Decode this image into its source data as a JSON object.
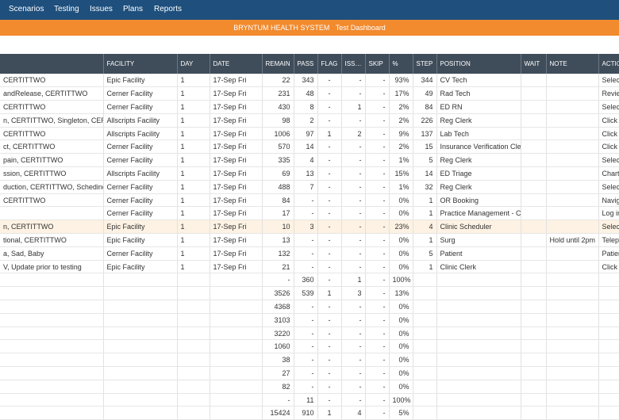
{
  "nav": {
    "items": [
      "Scenarios",
      "Testing",
      "Issues",
      "Plans",
      "Reports"
    ]
  },
  "banner": {
    "org": "BRYNTUM HEALTH SYSTEM",
    "title": "Test Dashboard"
  },
  "colors": {
    "nav_bg": "#1e4f7d",
    "banner_bg": "#f28a2e",
    "header_bg": "#3f4c5a",
    "highlight_row": "#fdf2e3"
  },
  "columns": [
    "",
    "FACILITY",
    "DAY",
    "DATE",
    "REMAIN",
    "PASS",
    "FLAG",
    "ISS…",
    "SKIP",
    "%",
    "STEP",
    "POSITION",
    "WAIT",
    "NOTE",
    "ACTIO"
  ],
  "rows": [
    {
      "name": "CERTITTWO",
      "facility": "Epic Facility",
      "day": "1",
      "date": "17-Sep Fri",
      "remain": "22",
      "pass": "343",
      "flag": "-",
      "issue": "-",
      "skip": "-",
      "pct": "93%",
      "step": "344",
      "position": "CV Tech",
      "wait": "",
      "note": "",
      "action": "Selec"
    },
    {
      "name": "andRelease, CERTITTWO",
      "facility": "Cerner Facility",
      "day": "1",
      "date": "17-Sep Fri",
      "remain": "231",
      "pass": "48",
      "flag": "-",
      "issue": "-",
      "skip": "-",
      "pct": "17%",
      "step": "49",
      "position": "Rad Tech",
      "wait": "",
      "note": "",
      "action": "Revie"
    },
    {
      "name": "CERTITTWO",
      "facility": "Cerner Facility",
      "day": "1",
      "date": "17-Sep Fri",
      "remain": "430",
      "pass": "8",
      "flag": "-",
      "issue": "1",
      "skip": "-",
      "pct": "2%",
      "step": "84",
      "position": "ED RN",
      "wait": "",
      "note": "",
      "action": "Selec"
    },
    {
      "name": "n, CERTITTWO, Singleton, CERT",
      "facility": "Allscripts Facility",
      "day": "1",
      "date": "17-Sep Fri",
      "remain": "98",
      "pass": "2",
      "flag": "-",
      "issue": "-",
      "skip": "-",
      "pct": "2%",
      "step": "226",
      "position": "Reg Clerk",
      "wait": "",
      "note": "",
      "action": "Click"
    },
    {
      "name": "CERTITTWO",
      "facility": "Allscripts Facility",
      "day": "1",
      "date": "17-Sep Fri",
      "remain": "1006",
      "pass": "97",
      "flag": "1",
      "issue": "2",
      "skip": "-",
      "pct": "9%",
      "step": "137",
      "position": "Lab Tech",
      "wait": "",
      "note": "",
      "action": "Click"
    },
    {
      "name": "ct, CERTITTWO",
      "facility": "Cerner Facility",
      "day": "1",
      "date": "17-Sep Fri",
      "remain": "570",
      "pass": "14",
      "flag": "-",
      "issue": "-",
      "skip": "-",
      "pct": "2%",
      "step": "15",
      "position": "Insurance Verification Cler",
      "wait": "",
      "note": "",
      "action": "Click"
    },
    {
      "name": "pain, CERTITTWO",
      "facility": "Cerner Facility",
      "day": "1",
      "date": "17-Sep Fri",
      "remain": "335",
      "pass": "4",
      "flag": "-",
      "issue": "-",
      "skip": "-",
      "pct": "1%",
      "step": "5",
      "position": "Reg Clerk",
      "wait": "",
      "note": "",
      "action": "Selec"
    },
    {
      "name": "ssion, CERTITTWO",
      "facility": "Allscripts Facility",
      "day": "1",
      "date": "17-Sep Fri",
      "remain": "69",
      "pass": "13",
      "flag": "-",
      "issue": "-",
      "skip": "-",
      "pct": "15%",
      "step": "14",
      "position": "ED Triage",
      "wait": "",
      "note": "",
      "action": "Chart"
    },
    {
      "name": "duction, CERTITTWO, Schedindu",
      "facility": "Cerner Facility",
      "day": "1",
      "date": "17-Sep Fri",
      "remain": "488",
      "pass": "7",
      "flag": "-",
      "issue": "-",
      "skip": "-",
      "pct": "1%",
      "step": "32",
      "position": "Reg Clerk",
      "wait": "",
      "note": "",
      "action": "Selec"
    },
    {
      "name": "CERTITTWO",
      "facility": "Cerner Facility",
      "day": "1",
      "date": "17-Sep Fri",
      "remain": "84",
      "pass": "-",
      "flag": "-",
      "issue": "-",
      "skip": "-",
      "pct": "0%",
      "step": "1",
      "position": "OR Booking",
      "wait": "",
      "note": "",
      "action": "Navig"
    },
    {
      "name": "",
      "facility": "Cerner Facility",
      "day": "1",
      "date": "17-Sep Fri",
      "remain": "17",
      "pass": "-",
      "flag": "-",
      "issue": "-",
      "skip": "-",
      "pct": "0%",
      "step": "1",
      "position": "Practice Management - Cle",
      "wait": "",
      "note": "",
      "action": "Log in"
    },
    {
      "name": "n, CERTITTWO",
      "facility": "Epic Facility",
      "day": "1",
      "date": "17-Sep Fri",
      "remain": "10",
      "pass": "3",
      "flag": "-",
      "issue": "-",
      "skip": "-",
      "pct": "23%",
      "step": "4",
      "position": "Clinic Scheduler",
      "wait": "",
      "note": "",
      "action": "Selec"
    },
    {
      "name": "tional, CERTITTWO",
      "facility": "Epic Facility",
      "day": "1",
      "date": "17-Sep Fri",
      "remain": "13",
      "pass": "-",
      "flag": "-",
      "issue": "-",
      "skip": "-",
      "pct": "0%",
      "step": "1",
      "position": "Surg",
      "wait": "",
      "note": "Hold until 2pm",
      "action": "Telep"
    },
    {
      "name": "a, Sad, Baby",
      "facility": "Cerner Facility",
      "day": "1",
      "date": "17-Sep Fri",
      "remain": "132",
      "pass": "-",
      "flag": "-",
      "issue": "-",
      "skip": "-",
      "pct": "0%",
      "step": "5",
      "position": "Patient",
      "wait": "",
      "note": "",
      "action": "Patien"
    },
    {
      "name": "V, Update prior to testing",
      "facility": "Epic Facility",
      "day": "1",
      "date": "17-Sep Fri",
      "remain": "21",
      "pass": "-",
      "flag": "-",
      "issue": "-",
      "skip": "-",
      "pct": "0%",
      "step": "1",
      "position": "Clinic Clerk",
      "wait": "",
      "note": "",
      "action": "Click"
    }
  ],
  "highlight_row_index": 11,
  "summary_rows": [
    {
      "remain": "-",
      "pass": "360",
      "flag": "-",
      "issue": "1",
      "skip": "-",
      "pct": "100%"
    },
    {
      "remain": "3526",
      "pass": "539",
      "flag": "1",
      "issue": "3",
      "skip": "-",
      "pct": "13%"
    },
    {
      "remain": "4368",
      "pass": "-",
      "flag": "-",
      "issue": "-",
      "skip": "-",
      "pct": "0%"
    },
    {
      "remain": "3103",
      "pass": "-",
      "flag": "-",
      "issue": "-",
      "skip": "-",
      "pct": "0%"
    },
    {
      "remain": "3220",
      "pass": "-",
      "flag": "-",
      "issue": "-",
      "skip": "-",
      "pct": "0%"
    },
    {
      "remain": "1060",
      "pass": "-",
      "flag": "-",
      "issue": "-",
      "skip": "-",
      "pct": "0%"
    },
    {
      "remain": "38",
      "pass": "-",
      "flag": "-",
      "issue": "-",
      "skip": "-",
      "pct": "0%"
    },
    {
      "remain": "27",
      "pass": "-",
      "flag": "-",
      "issue": "-",
      "skip": "-",
      "pct": "0%"
    },
    {
      "remain": "82",
      "pass": "-",
      "flag": "-",
      "issue": "-",
      "skip": "-",
      "pct": "0%"
    },
    {
      "remain": "-",
      "pass": "11",
      "flag": "-",
      "issue": "-",
      "skip": "-",
      "pct": "100%"
    },
    {
      "remain": "15424",
      "pass": "910",
      "flag": "1",
      "issue": "4",
      "skip": "-",
      "pct": "5%"
    }
  ]
}
